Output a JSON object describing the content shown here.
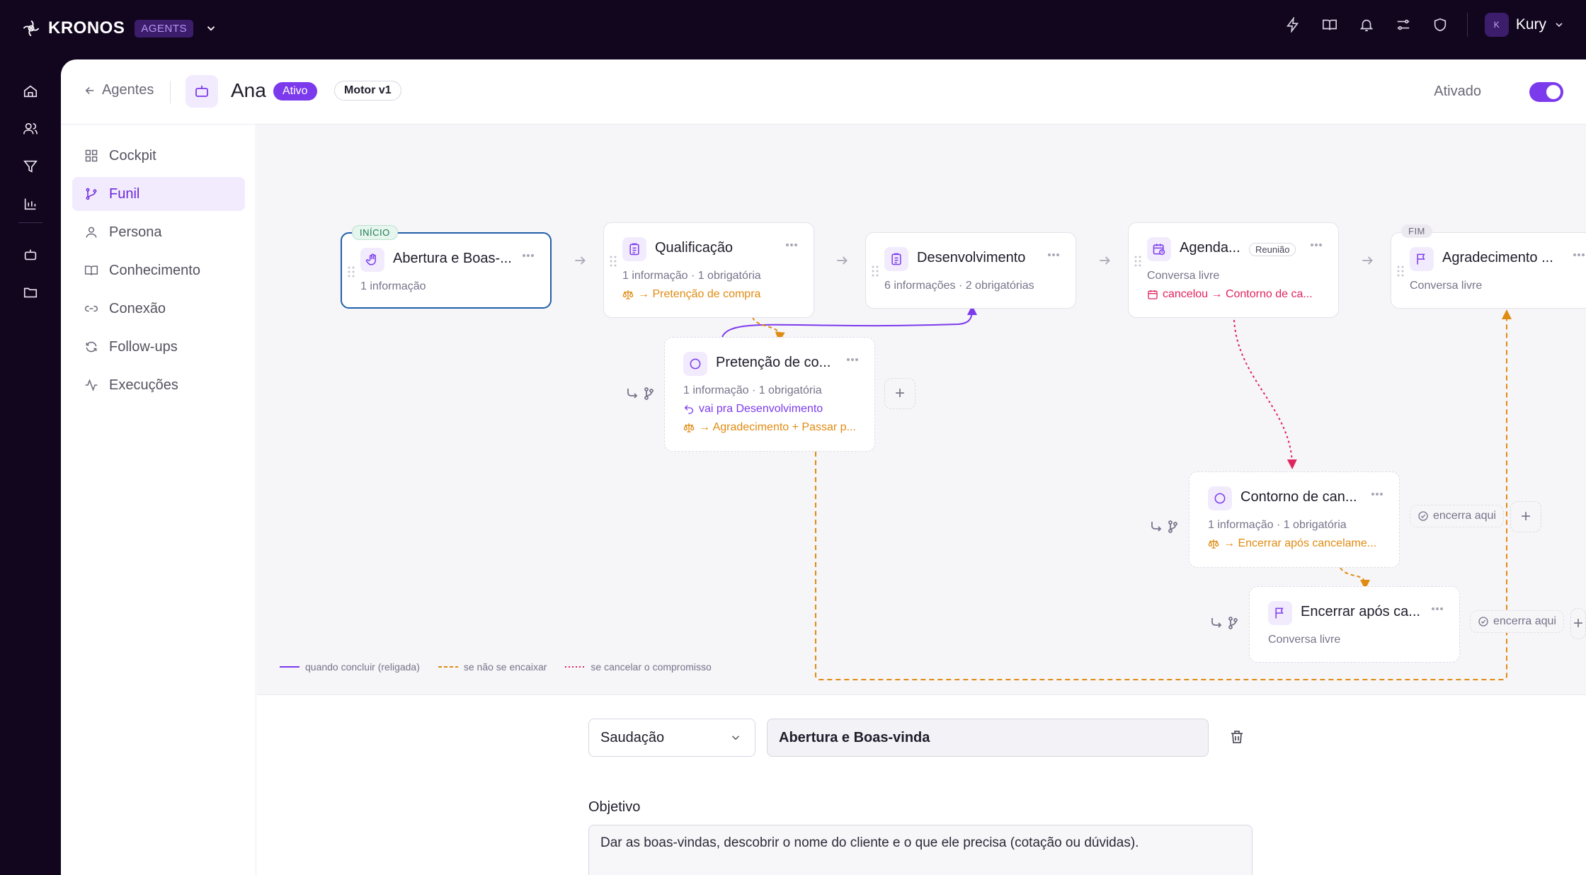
{
  "brand": {
    "name": "KRONOS",
    "badge": "AGENTS"
  },
  "user": {
    "initial": "K",
    "name": "Kury"
  },
  "header": {
    "back_label": "Agentes",
    "agent_name": "Ana",
    "status_badge": "Ativo",
    "engine_badge": "Motor v1",
    "toggle_label": "Ativado",
    "toggle_on": true
  },
  "sidebar": {
    "items": [
      {
        "label": "Cockpit"
      },
      {
        "label": "Funil",
        "active": true
      },
      {
        "label": "Persona"
      },
      {
        "label": "Conhecimento"
      },
      {
        "label": "Conexão"
      },
      {
        "label": "Follow-ups"
      },
      {
        "label": "Execuções"
      }
    ]
  },
  "flow": {
    "nodes": {
      "abertura": {
        "tag": "INÍCIO",
        "title": "Abertura e Boas-...",
        "sub": "1 informação"
      },
      "qualificacao": {
        "title": "Qualificação",
        "sub": "1 informação · 1 obrigatória",
        "branch": "→ Pretenção de compra"
      },
      "desenvolvimento": {
        "title": "Desenvolvimento",
        "sub": "6 informações · 2 obrigatórias"
      },
      "agendamento": {
        "title": "Agenda...",
        "badge": "Reunião",
        "sub": "Conversa livre",
        "cancel": "cancelou → Contorno de ca..."
      },
      "agradecimento": {
        "tag": "FIM",
        "title": "Agradecimento ...",
        "sub": "Conversa livre"
      },
      "pretencao": {
        "title": "Pretenção de co...",
        "sub": "1 informação · 1 obrigatória",
        "goto": "vai pra Desenvolvimento",
        "branch": "→ Agradecimento + Passar p..."
      },
      "contorno": {
        "title": "Contorno de can...",
        "sub": "1 informação · 1 obrigatória",
        "branch": "→ Encerrar após cancelame...",
        "ends": "encerra aqui"
      },
      "encerrar": {
        "title": "Encerrar após ca...",
        "sub": "Conversa livre",
        "ends": "encerra aqui"
      }
    },
    "legend": {
      "relinked": "quando concluir (religada)",
      "fallback": "se não se encaixar",
      "cancel": "se cancelar o compromisso"
    },
    "colors": {
      "purple": "#7c3aed",
      "orange": "#e08b12",
      "red": "#e0245e",
      "selected": "#1f5fa8"
    }
  },
  "form": {
    "type_value": "Saudação",
    "name_value": "Abertura e Boas-vinda",
    "objective_label": "Objetivo",
    "objective_value": "Dar as boas-vindas, descobrir o nome do cliente e o que ele precisa (cotação ou dúvidas)."
  }
}
